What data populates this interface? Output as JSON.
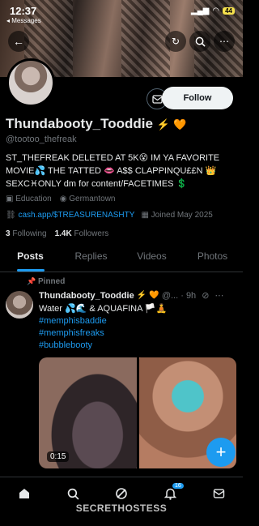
{
  "status_bar": {
    "time": "12:37",
    "back_label": "◂ Messages",
    "battery": "44"
  },
  "profile": {
    "name": "Thundabooty_Tooddie",
    "name_emojis": "⚡️ 🧡",
    "handle": "@tootoo_thefreak",
    "bio": "ST_THEFREAK DELETED AT 5K😵 IM YA FAVORITE MOVIE💦 THE TATTED 👄 A$$ CLAPPINQU££N 👑 SEXC♓ONLY dm for content/FACETIMES 💲",
    "category": "Education",
    "location": "Germantown",
    "link": "cash.app/$TREASURENASHTY",
    "joined": "Joined May 2025",
    "following_count": "3",
    "following_label": "Following",
    "followers_count": "1.4K",
    "followers_label": "Followers",
    "follow_label": "Follow"
  },
  "tabs": [
    "Posts",
    "Replies",
    "Videos",
    "Photos"
  ],
  "pinned_post": {
    "pinned_label": "Pinned",
    "author": "Thundabooty_Tooddie",
    "author_emojis": "⚡️ 🧡",
    "meta": "@... · 9h",
    "text": "Water 💦🌊 & AQUAFINA 🏳️🧘",
    "hashtags": [
      "#memphisbaddie",
      "#memphisfreaks",
      "#bubblebooty"
    ],
    "video_duration": "0:15"
  },
  "nav": {
    "badge": "16"
  },
  "watermark": "SECRETHOSTESS"
}
